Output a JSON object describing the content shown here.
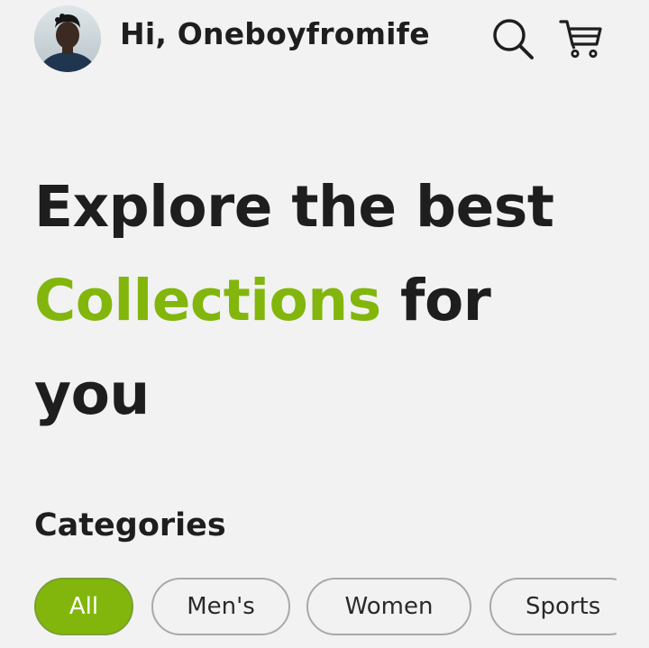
{
  "header": {
    "greeting": "Hi, Oneboyfromife",
    "avatar_icon": "user-avatar",
    "search_icon": "search-icon",
    "cart_icon": "cart-icon"
  },
  "hero": {
    "line1": "Explore the best",
    "accent": "Collections",
    "line2_rest": " for",
    "line3": "you",
    "accent_color": "#82b60c"
  },
  "categories": {
    "title": "Categories",
    "items": [
      {
        "label": "All",
        "active": true
      },
      {
        "label": "Men's",
        "active": false
      },
      {
        "label": "Women",
        "active": false
      },
      {
        "label": "Sports",
        "active": false
      }
    ]
  }
}
